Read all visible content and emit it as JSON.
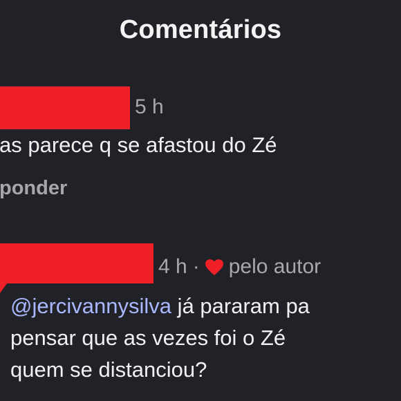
{
  "header": {
    "title": "Comentários"
  },
  "comments": [
    {
      "time": "5 h",
      "text": "as parece q se afastou do Zé",
      "reply_label": "ponder"
    },
    {
      "time": "4 h",
      "separator": "·",
      "liked_by_author_label": "pelo autor",
      "mention": "@jercivannysilva",
      "text_line_1_rest": " já pararam pa",
      "text_line_2": "pensar que as vezes foi o Zé",
      "text_line_3": "quem se distanciou?"
    }
  ],
  "colors": {
    "background": "#202227",
    "redaction": "#ef2028",
    "heart": "#ef2028",
    "mention": "#a9b7ff",
    "meta_text": "#a8a9ad",
    "primary_text": "#f1f1f1"
  },
  "icons": {
    "liked_by_author": "heart-icon"
  }
}
